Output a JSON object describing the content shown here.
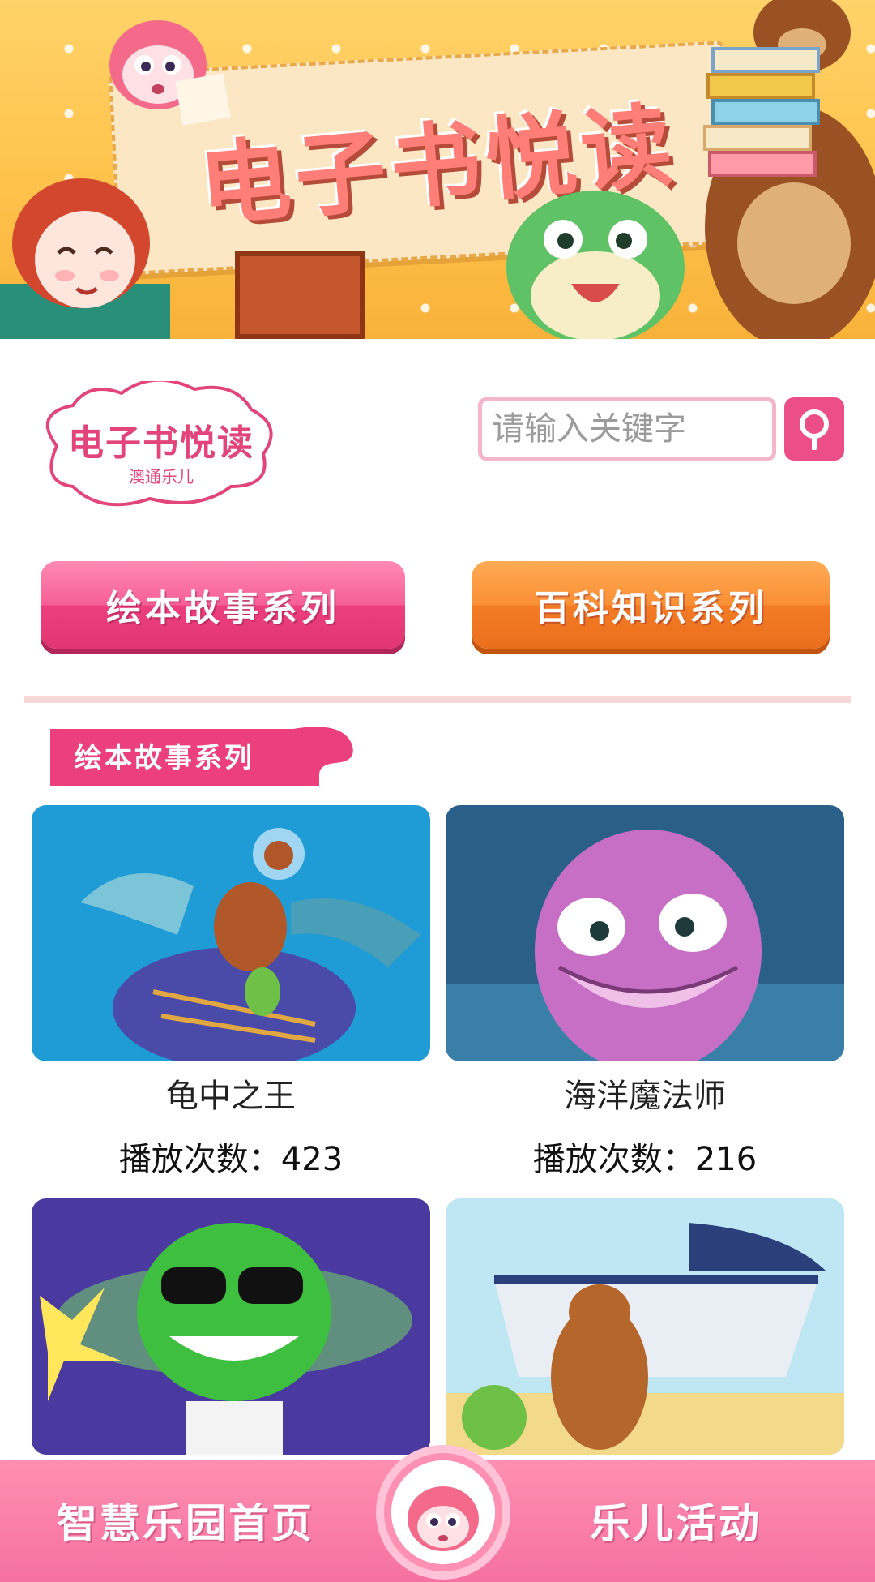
{
  "banner": {
    "title": "电子书悦读"
  },
  "brand": {
    "name": "电子书悦读",
    "subtitle": "澳通乐儿"
  },
  "search": {
    "placeholder": "请输入关键字",
    "value": ""
  },
  "categories": [
    {
      "label": "绘本故事系列",
      "color": "#ec3f7e"
    },
    {
      "label": "百科知识系列",
      "color": "#f47c25"
    }
  ],
  "section": {
    "title": "绘本故事系列"
  },
  "books": [
    {
      "title": "龟中之王",
      "plays": "播放次数：423"
    },
    {
      "title": "海洋魔法师",
      "plays": "播放次数：216"
    },
    {
      "title": "",
      "plays": ""
    },
    {
      "title": "",
      "plays": ""
    }
  ],
  "nav": {
    "home": "智慧乐园首页",
    "activity": "乐儿活动"
  },
  "colors": {
    "accent_pink": "#ec4f88",
    "accent_orange": "#f47c25",
    "nav_pink": "#f5719f"
  }
}
